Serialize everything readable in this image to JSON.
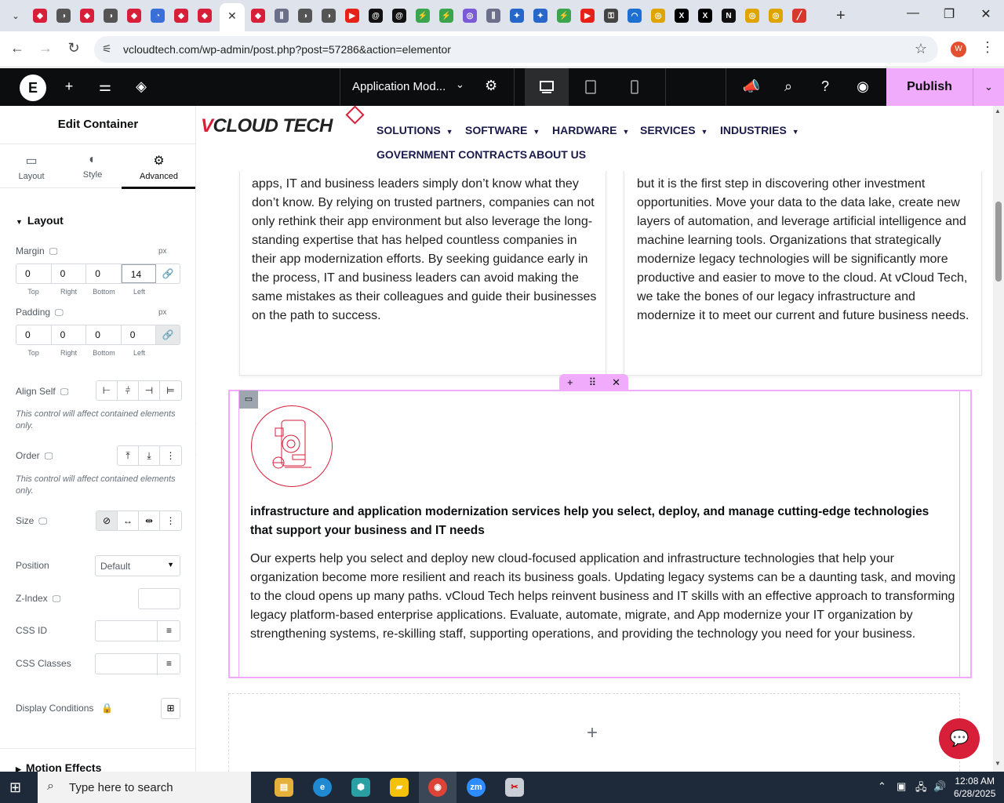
{
  "browser": {
    "tab_count_icons": [
      "gplus",
      "circle",
      "gplus",
      "circle",
      "gplus",
      "edge",
      "gplus",
      "gplus",
      "gplus",
      "gplus",
      "twitch",
      "circle",
      "circle",
      "youtube",
      "threads",
      "threads",
      "sticky",
      "sticky",
      "opera",
      "twitch",
      "puzzle",
      "puzzle",
      "sticky",
      "youtube",
      "lock",
      "wifi",
      "chrome",
      "x",
      "x",
      "notion",
      "chrome",
      "chrome",
      "pen"
    ],
    "active_tab_close": "✕",
    "new_tab": "+",
    "url": "vcloudtech.com/wp-admin/post.php?post=57286&action=elementor",
    "profile_initial": "W",
    "window_controls": [
      "—",
      "❐",
      "✕"
    ]
  },
  "editor_top": {
    "document_name": "Application Mod...",
    "publish_label": "Publish"
  },
  "panel": {
    "title": "Edit Container",
    "tabs": [
      {
        "label": "Layout",
        "icon": "▭"
      },
      {
        "label": "Style",
        "icon": "◐"
      },
      {
        "label": "Advanced",
        "icon": "⚙"
      }
    ],
    "section_layout": "Layout",
    "margin": {
      "label": "Margin",
      "unit": "px",
      "values": [
        "0",
        "0",
        "0",
        "14"
      ],
      "sublabels": [
        "Top",
        "Right",
        "Bottom",
        "Left"
      ]
    },
    "padding": {
      "label": "Padding",
      "unit": "px",
      "values": [
        "0",
        "0",
        "0",
        "0"
      ],
      "sublabels": [
        "Top",
        "Right",
        "Bottom",
        "Left"
      ]
    },
    "align_self": "Align Self",
    "align_hint": "This control will affect contained elements only.",
    "order": "Order",
    "order_hint": "This control will affect contained elements only.",
    "size": "Size",
    "position_label": "Position",
    "position_value": "Default",
    "zindex_label": "Z-Index",
    "cssid_label": "CSS ID",
    "cssclasses_label": "CSS Classes",
    "display_conditions": "Display Conditions",
    "motion_effects": "Motion Effects"
  },
  "site": {
    "brand_prefix": "V",
    "brand_rest": "CLOUD TECH",
    "nav": [
      {
        "label": "SOLUTIONS",
        "dropdown": true
      },
      {
        "label": "SOFTWARE",
        "dropdown": true
      },
      {
        "label": "HARDWARE",
        "dropdown": true
      },
      {
        "label": "SERVICES",
        "dropdown": true
      },
      {
        "label": "INDUSTRIES",
        "dropdown": true
      },
      {
        "label": "GOVERNMENT CONTRACTS",
        "dropdown": false
      },
      {
        "label": "ABOUT US",
        "dropdown": false
      }
    ],
    "card_left_text": "apps, IT and business leaders simply don’t know what they don’t know. By relying on trusted partners, companies can not only rethink their app environment but also leverage the long-standing expertise that has helped countless companies in their app modernization efforts. By seeking guidance early in the process, IT and business leaders can avoid making the same mistakes as their colleagues and guide their businesses on the path to success.",
    "card_right_text": "but it is the first step in discovering other investment opportunities. Move your data to the data lake, create new layers of automation, and leverage artificial intelligence and machine learning tools. Organizations that strategically modernize legacy technologies will be significantly more productive and easier to move to the cloud. At vCloud Tech, we take the bones of our legacy infrastructure and modernize it to meet our current and future business needs.",
    "section_heading": "infrastructure and application modernization services help you select, deploy, and manage cutting-edge technologies that support your business and IT needs",
    "section_body": "Our experts help you select and deploy new cloud-focused application and infrastructure technologies that help your organization become more resilient and reach its business goals. Updating legacy systems can be a daunting task, and moving to the cloud opens up many paths. vCloud Tech helps reinvent business and IT skills with an effective approach to transforming legacy platform-based enterprise applications. Evaluate, automate, migrate, and App modernize your IT organization by strengthening systems, re-skilling staff, supporting operations, and providing the technology you need for your business."
  },
  "taskbar": {
    "search_placeholder": "Type here to search",
    "time": "12:08 AM",
    "date": "6/28/2025"
  },
  "colors": {
    "accent_pink": "#f0abfc",
    "brand_red": "#d81f3a",
    "elementor_dark": "#0c0d0e"
  }
}
